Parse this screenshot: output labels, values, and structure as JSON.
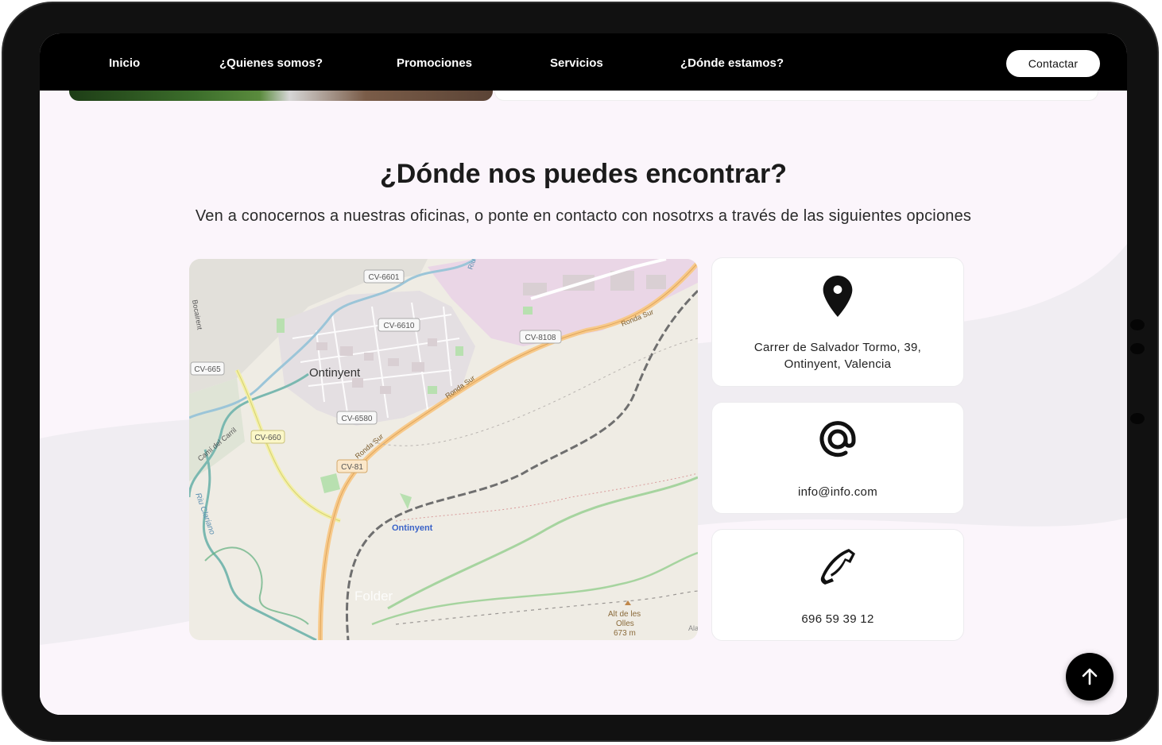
{
  "nav": {
    "items": [
      {
        "label": "Inicio"
      },
      {
        "label": "¿Quienes somos?"
      },
      {
        "label": "Promociones"
      },
      {
        "label": "Servicios"
      },
      {
        "label": "¿Dónde estamos?"
      }
    ],
    "contact_label": "Contactar"
  },
  "section": {
    "title": "¿Dónde nos puedes encontrar?",
    "subtitle": "Ven a conocernos a nuestras oficinas, o ponte en contacto con nosotrxs a través de las siguientes opciones"
  },
  "map": {
    "labels": {
      "cv6601": "CV-6601",
      "cv6610": "CV-6610",
      "cv8108": "CV-8108",
      "cv665": "CV-665",
      "cv6580": "CV-6580",
      "cv660": "CV-660",
      "cv81": "CV-81",
      "town": "Ontinyent",
      "station": "Ontinyent",
      "ronda1": "Ronda Sur",
      "ronda2": "Ronda Sur",
      "ronda3": "Ronda Sur",
      "cami": "Camí del Carril",
      "riu": "Riu Clariano",
      "folder": "Folder",
      "alt1": "Alt de les",
      "alt2": "Olles",
      "alt3": "673 m",
      "edge_left": "Bocairent",
      "edge_top": "Riu",
      "edge_bottom": "Ala"
    }
  },
  "contact": {
    "address": "Carrer de Salvador Tormo, 39, Ontinyent, Valencia",
    "email": "info@info.com",
    "phone": "696 59 39 12"
  },
  "icons": {
    "location": "map-pin-icon",
    "email": "at-sign-icon",
    "phone": "phone-icon",
    "scroll": "arrow-up-icon"
  }
}
